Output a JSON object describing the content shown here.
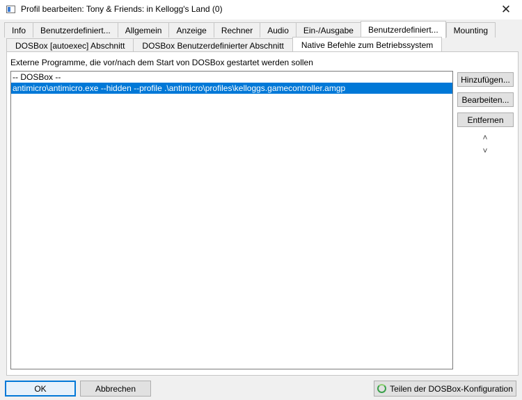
{
  "window": {
    "title": "Profil bearbeiten: Tony & Friends: in Kellogg's Land (0)",
    "close_glyph": "✕"
  },
  "tabs": [
    {
      "label": "Info",
      "active": false
    },
    {
      "label": "Benutzerdefiniert...",
      "active": false
    },
    {
      "label": "Allgemein",
      "active": false
    },
    {
      "label": "Anzeige",
      "active": false
    },
    {
      "label": "Rechner",
      "active": false
    },
    {
      "label": "Audio",
      "active": false
    },
    {
      "label": "Ein-/Ausgabe",
      "active": false
    },
    {
      "label": "Benutzerdefiniert...",
      "active": true
    },
    {
      "label": "Mounting",
      "active": false
    }
  ],
  "subtabs": [
    {
      "label": "DOSBox [autoexec] Abschnitt",
      "active": false
    },
    {
      "label": "DOSBox Benutzerdefinierter Abschnitt",
      "active": false
    },
    {
      "label": "Native Befehle zum Betriebssystem",
      "active": true
    }
  ],
  "main": {
    "description": "Externe Programme, die vor/nach dem Start von DOSBox gestartet werden sollen",
    "list": [
      {
        "text": "-- DOSBox --",
        "selected": false
      },
      {
        "text": "antimicro\\antimicro.exe --hidden --profile .\\antimicro\\profiles\\kelloggs.gamecontroller.amgp",
        "selected": true
      }
    ]
  },
  "side_buttons": {
    "add": "Hinzufügen...",
    "edit": "Bearbeiten...",
    "remove": "Entfernen",
    "up_glyph": "˄",
    "down_glyph": "˅"
  },
  "footer": {
    "ok": "OK",
    "cancel": "Abbrechen",
    "share": "Teilen der DOSBox-Konfiguration"
  },
  "colors": {
    "selection": "#0078d7",
    "share_icon": "#3aa04a"
  }
}
